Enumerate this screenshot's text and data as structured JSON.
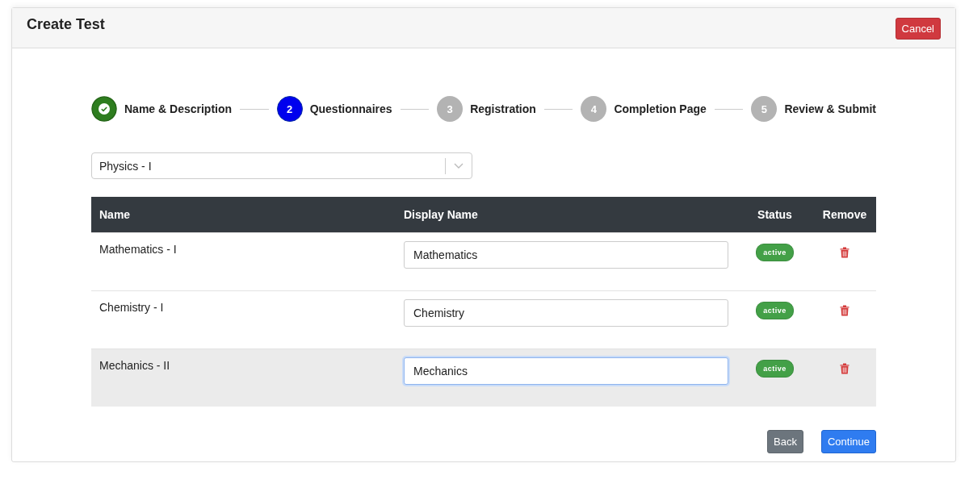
{
  "header": {
    "title": "Create Test",
    "cancel_button": "Cancel"
  },
  "steps": [
    {
      "label": "Name & Description",
      "completed": true,
      "selected": false
    },
    {
      "number": "2",
      "label": "Questionnaires",
      "completed": false,
      "selected": true
    },
    {
      "number": "3",
      "label": "Registration",
      "completed": false,
      "selected": false
    },
    {
      "number": "4",
      "label": "Completion Page",
      "completed": false,
      "selected": false
    },
    {
      "number": "5",
      "label": "Review & Submit",
      "completed": false,
      "selected": false
    }
  ],
  "select": {
    "value": "Physics - I"
  },
  "table": {
    "columns": [
      "Name",
      "Display Name",
      "Status",
      "Remove"
    ],
    "rows": [
      {
        "name": "Mathematics - I",
        "display_name": "Mathematics",
        "status": "active",
        "focused": false
      },
      {
        "name": "Chemistry - I",
        "display_name": "Chemistry",
        "status": "active",
        "focused": false
      },
      {
        "name": "Mechanics - II",
        "display_name": "Mechanics",
        "status": "active",
        "focused": true
      }
    ]
  },
  "buttons": {
    "back": "Back",
    "continue": "Continue"
  }
}
